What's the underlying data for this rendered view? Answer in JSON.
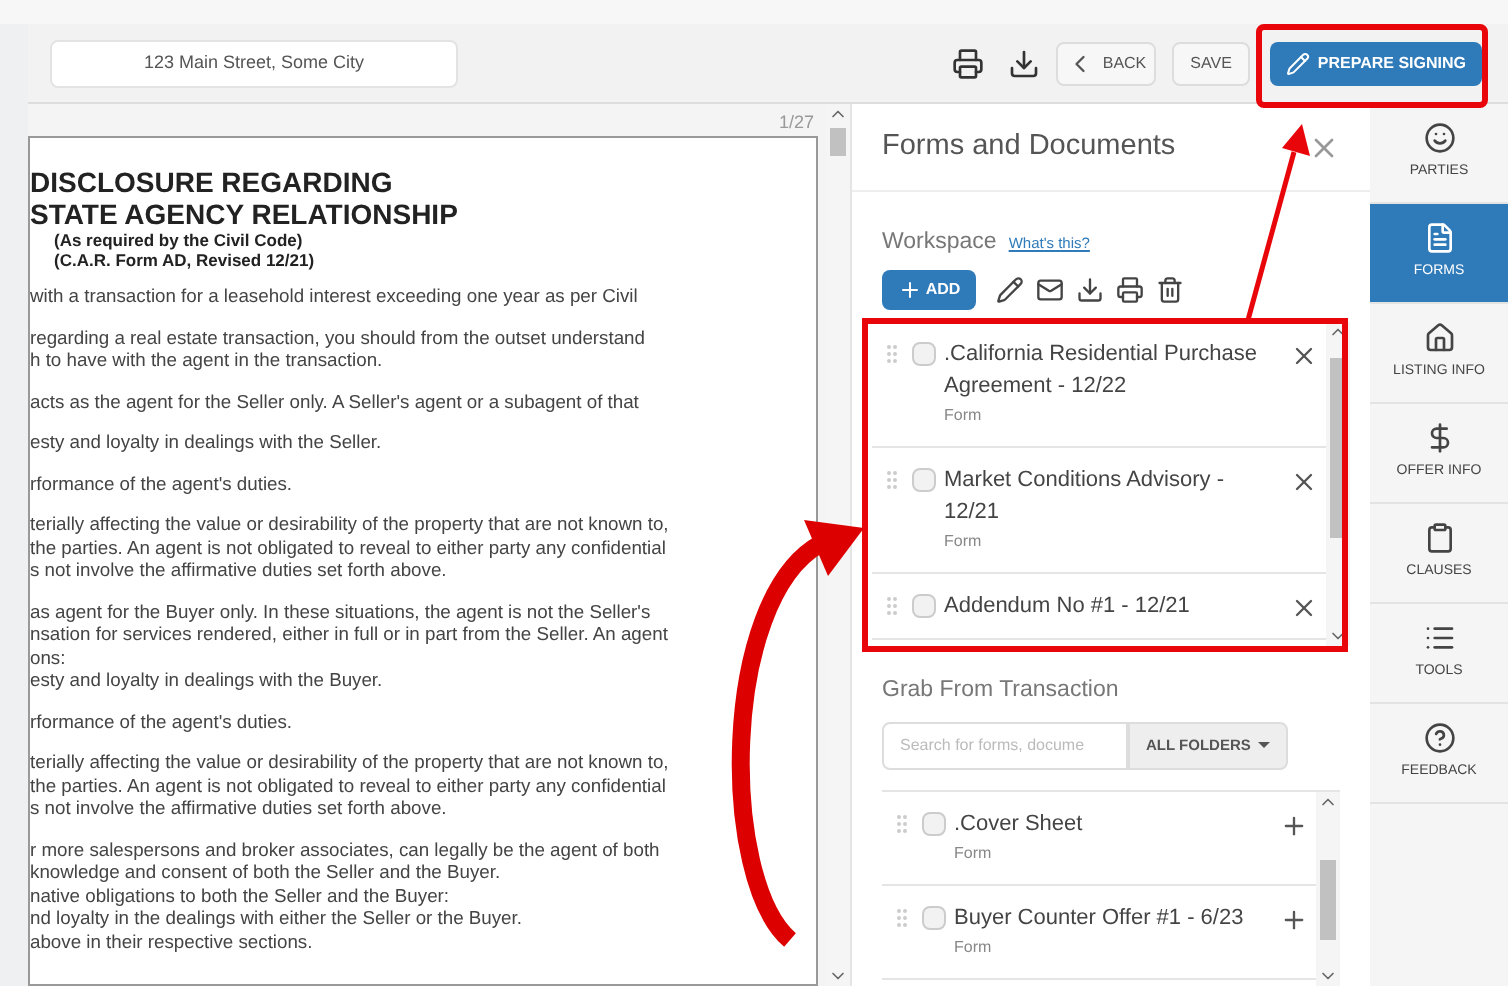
{
  "toolbar": {
    "address": "123 Main Street, Some City",
    "back": "BACK",
    "save": "SAVE",
    "prepare": "PREPARE SIGNING"
  },
  "document": {
    "page": "1/27",
    "title": [
      "DISCLOSURE REGARDING",
      "STATE AGENCY RELATIONSHIP"
    ],
    "subtitle": [
      "(As required by the Civil Code)",
      "(C.A.R. Form AD, Revised 12/21)"
    ],
    "paragraphs": [
      "with a transaction for a leasehold interest exceeding one year as per Civil",
      "regarding a real estate transaction, you should from the outset understand\nh to have with the agent in the transaction.",
      "acts as the agent for the Seller only. A Seller's agent or a subagent of that",
      "esty and loyalty in dealings with the Seller.",
      "rformance of the agent's duties.",
      "terially affecting the value or desirability of the property that are not known to,\nthe parties. An agent is not obligated to reveal to either party any confidential\ns not involve the affirmative duties set forth above.",
      "as agent for the Buyer only. In these situations, the agent is not the Seller's\nnsation for services rendered, either in full or in part from the Seller. An agent\nons:\nesty and loyalty in dealings with the Buyer.",
      "rformance of the agent's duties.",
      "terially affecting the value or desirability of the property that are not known to,\nthe parties. An agent is not obligated to reveal to either party any confidential\ns not involve the affirmative duties set forth above.",
      "r more salespersons and broker associates, can legally be the agent of both\nknowledge and consent of both the Seller and the Buyer.\nnative obligations to both the Seller and the Buyer:\nnd loyalty in the dealings with either the Seller or the Buyer.\nabove in their respective sections."
    ]
  },
  "panel": {
    "title": "Forms and Documents",
    "workspace": {
      "label": "Workspace",
      "link": "What's this?",
      "add": "ADD",
      "items": [
        {
          "title": ".California Residential Purchase Agreement - 12/22",
          "type": "Form",
          "checked": false
        },
        {
          "title": "Market Conditions Advisory - 12/21",
          "type": "Form",
          "checked": false
        },
        {
          "title": "Addendum No #1 - 12/21",
          "checked": false
        }
      ]
    },
    "grab": {
      "label": "Grab From Transaction",
      "placeholder": "Search for forms, docume",
      "folders": "ALL FOLDERS",
      "items": [
        {
          "title": ".Cover Sheet",
          "type": "Form",
          "checked": false
        },
        {
          "title": "Buyer Counter Offer #1 - 6/23",
          "type": "Form",
          "checked": false
        }
      ]
    }
  },
  "sidebar": [
    {
      "kind": "parties",
      "label": "PARTIES",
      "selected": false
    },
    {
      "kind": "forms",
      "label": "FORMS",
      "selected": true
    },
    {
      "kind": "listing",
      "label": "LISTING INFO",
      "selected": false
    },
    {
      "kind": "offer",
      "label": "OFFER INFO",
      "selected": false
    },
    {
      "kind": "clauses",
      "label": "CLAUSES",
      "selected": false
    },
    {
      "kind": "tools",
      "label": "TOOLS",
      "selected": false
    },
    {
      "kind": "feedback",
      "label": "FEEDBACK",
      "selected": false
    }
  ]
}
